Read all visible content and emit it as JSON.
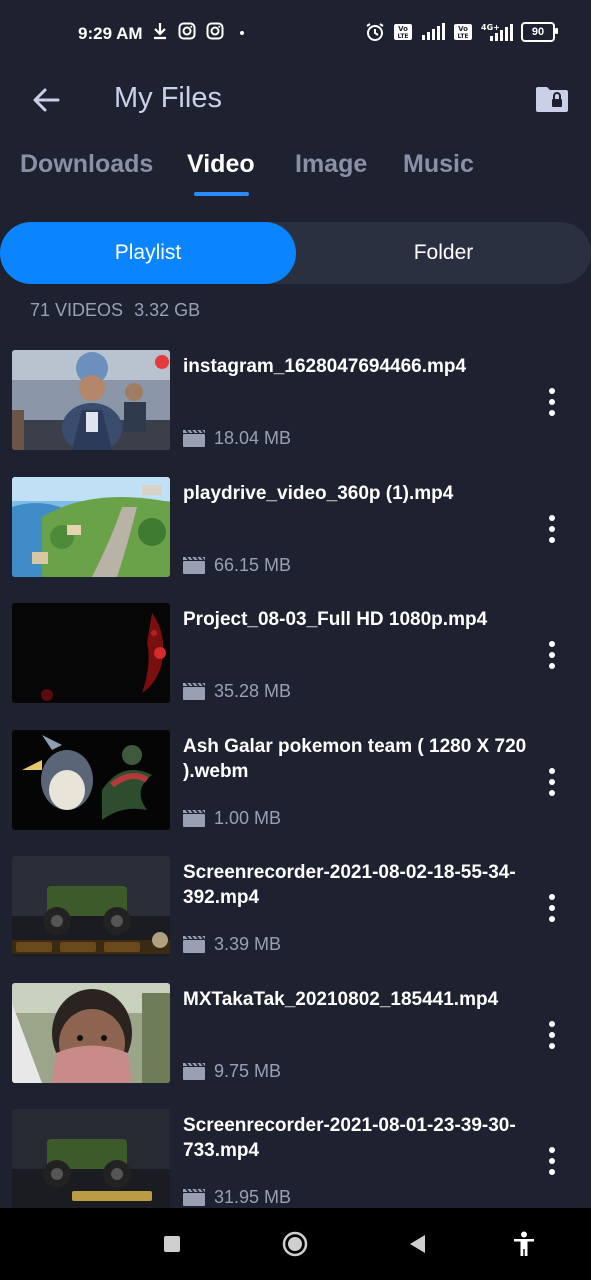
{
  "status_bar": {
    "time": "9:29 AM",
    "left_icons": [
      "download-icon",
      "instagram-icon",
      "instagram-icon",
      "dot-icon"
    ],
    "right_icons": [
      "alarm-icon",
      "volte-icon",
      "signal-icon",
      "volte-icon",
      "signal-4g-icon"
    ],
    "battery": "90"
  },
  "app_bar": {
    "title": "My Files",
    "back_icon": "back-arrow-icon",
    "lock_icon": "private-folder-icon"
  },
  "tabs": [
    {
      "label": "Downloads",
      "active": false
    },
    {
      "label": "Video",
      "active": true
    },
    {
      "label": "Image",
      "active": false
    },
    {
      "label": "Music",
      "active": false
    }
  ],
  "segment": {
    "playlist_label": "Playlist",
    "folder_label": "Folder",
    "selected": "Playlist"
  },
  "summary": {
    "count": "71 VIDEOS",
    "size": "3.32 GB"
  },
  "videos": [
    {
      "name": "instagram_1628047694466.mp4",
      "size": "18.04 MB"
    },
    {
      "name": "playdrive_video_360p (1).mp4",
      "size": "66.15 MB"
    },
    {
      "name": "Project_08-03_Full HD 1080p.mp4",
      "size": "35.28 MB"
    },
    {
      "name": "Ash Galar pokemon team ( 1280 X 720 ).webm",
      "size": "1.00 MB"
    },
    {
      "name": "Screenrecorder-2021-08-02-18-55-34-392.mp4",
      "size": "3.39 MB"
    },
    {
      "name": "MXTakaTak_20210802_185441.mp4",
      "size": "9.75 MB"
    },
    {
      "name": "Screenrecorder-2021-08-01-23-39-30-733.mp4",
      "size": "31.95 MB"
    }
  ],
  "nav_bar": {
    "icons": [
      "recents-square-icon",
      "home-circle-icon",
      "back-triangle-icon",
      "accessibility-icon"
    ]
  },
  "colors": {
    "background": "#1e2130",
    "accent": "#0a84ff",
    "segment_bg": "#2b3040",
    "muted_text": "#9aa0b4"
  }
}
